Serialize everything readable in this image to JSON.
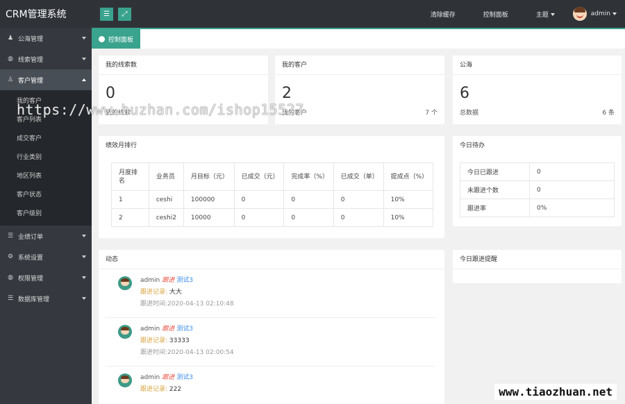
{
  "app": {
    "title": "CRM管理系统"
  },
  "header": {
    "clear_cache": "清除缓存",
    "dashboard": "控制面板",
    "theme": "主题",
    "user": "admin"
  },
  "sidebar": {
    "items": [
      {
        "label": "公海管理",
        "icon": "users-icon"
      },
      {
        "label": "线索管理",
        "icon": "globe-icon"
      },
      {
        "label": "客户管理",
        "icon": "user-icon"
      },
      {
        "label": "业绩订单",
        "icon": "database-icon"
      },
      {
        "label": "系统设置",
        "icon": "wrench-icon"
      },
      {
        "label": "权限管理",
        "icon": "globe-icon"
      },
      {
        "label": "数据库管理",
        "icon": "database-icon"
      }
    ],
    "sub_items": [
      "我的客户",
      "客户列表",
      "成交客户",
      "行业类别",
      "地区列表",
      "客户状态",
      "客户级别"
    ]
  },
  "tab": {
    "label": "控制面板"
  },
  "stats": [
    {
      "title": "我的线索数",
      "value": "0",
      "foot_left": "我的线索",
      "foot_right": ""
    },
    {
      "title": "我的客户",
      "value": "2",
      "foot_left": "我的客户",
      "foot_right": "7 个"
    },
    {
      "title": "公海",
      "value": "6",
      "foot_left": "总数据",
      "foot_right": "6 条"
    }
  ],
  "performance": {
    "title": "绩效月排行",
    "headers": [
      "月度排名",
      "业务员",
      "月目标（元）",
      "已成交（元）",
      "完成率（%）",
      "已成交（单）",
      "提成点（%）"
    ],
    "rows": [
      [
        "1",
        "ceshi",
        "100000",
        "0",
        "0",
        "0",
        "10%"
      ],
      [
        "2",
        "ceshi2",
        "10000",
        "0",
        "0",
        "0",
        "10%"
      ]
    ]
  },
  "todo": {
    "title": "今日待办",
    "rows": [
      [
        "今日已跟进",
        "0"
      ],
      [
        "未跟进个数",
        "0"
      ],
      [
        "跟进率",
        "0%"
      ]
    ]
  },
  "reminder": {
    "title": "今日跟进提醒"
  },
  "feed": {
    "title": "动态",
    "items": [
      {
        "user": "admin",
        "action": "跟进",
        "customer": "测试3",
        "record_label": "跟进记录:",
        "record": "大大",
        "time_label": "跟进时间:",
        "time": "2020-04-13 02:10:48"
      },
      {
        "user": "admin",
        "action": "跟进",
        "customer": "测试3",
        "record_label": "跟进记录:",
        "record": "33333",
        "time_label": "跟进时间:",
        "time": "2020-04-13 02:00:54"
      },
      {
        "user": "admin",
        "action": "跟进",
        "customer": "测试3",
        "record_label": "跟进记录:",
        "record": "222",
        "time_label": "",
        "time": ""
      }
    ]
  },
  "watermarks": {
    "top": "https://www.huzhan.com/ishop15527",
    "bottom": "www.tiaozhuan.net"
  },
  "colors": {
    "accent": "#3aa38e",
    "topbar": "#2f3338",
    "sidebar": "#35393f"
  }
}
